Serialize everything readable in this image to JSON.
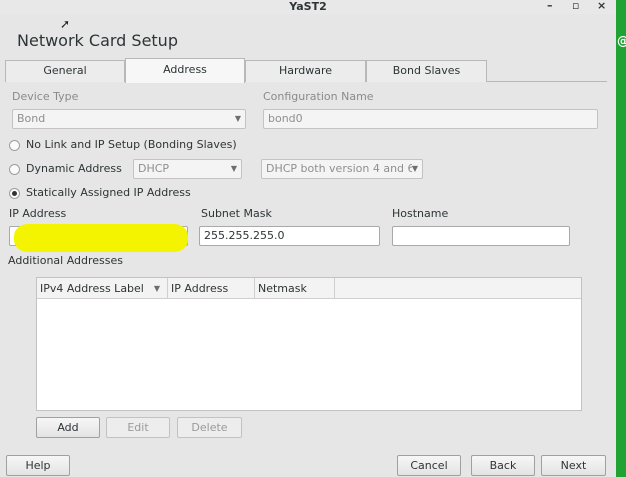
{
  "window": {
    "title": "YaST2",
    "minimize": "–",
    "maximize": "▫",
    "close": "×"
  },
  "dialog": {
    "title": "Network Card Setup"
  },
  "tabs": [
    {
      "label": "General",
      "active": false
    },
    {
      "label": "Address",
      "active": true
    },
    {
      "label": "Hardware",
      "active": false
    },
    {
      "label": "Bond Slaves",
      "active": false
    }
  ],
  "device_type": {
    "label": "Device Type",
    "value": "Bond"
  },
  "configuration_name": {
    "label": "Configuration Name",
    "value": "bond0"
  },
  "options": {
    "no_link": "No Link and IP Setup (Bonding Slaves)",
    "dynamic": "Dynamic Address",
    "dynamic_select": "DHCP",
    "dhcp_version_select": "DHCP both version 4 and 6",
    "static": "Statically Assigned IP Address",
    "selected": "static"
  },
  "ip_address": {
    "label": "IP Address",
    "value": ""
  },
  "subnet_mask": {
    "label": "Subnet Mask",
    "value": "255.255.255.0"
  },
  "hostname": {
    "label": "Hostname",
    "value": ""
  },
  "additional": {
    "label": "Additional Addresses",
    "columns": [
      "IPv4 Address Label",
      "IP Address",
      "Netmask"
    ],
    "rows": []
  },
  "buttons": {
    "add": "Add",
    "edit": "Edit",
    "delete": "Delete",
    "help": "Help",
    "cancel": "Cancel",
    "back": "Back",
    "next": "Next"
  },
  "colors": {
    "highlight": "#f4f400",
    "side_strip": "#21a334"
  }
}
